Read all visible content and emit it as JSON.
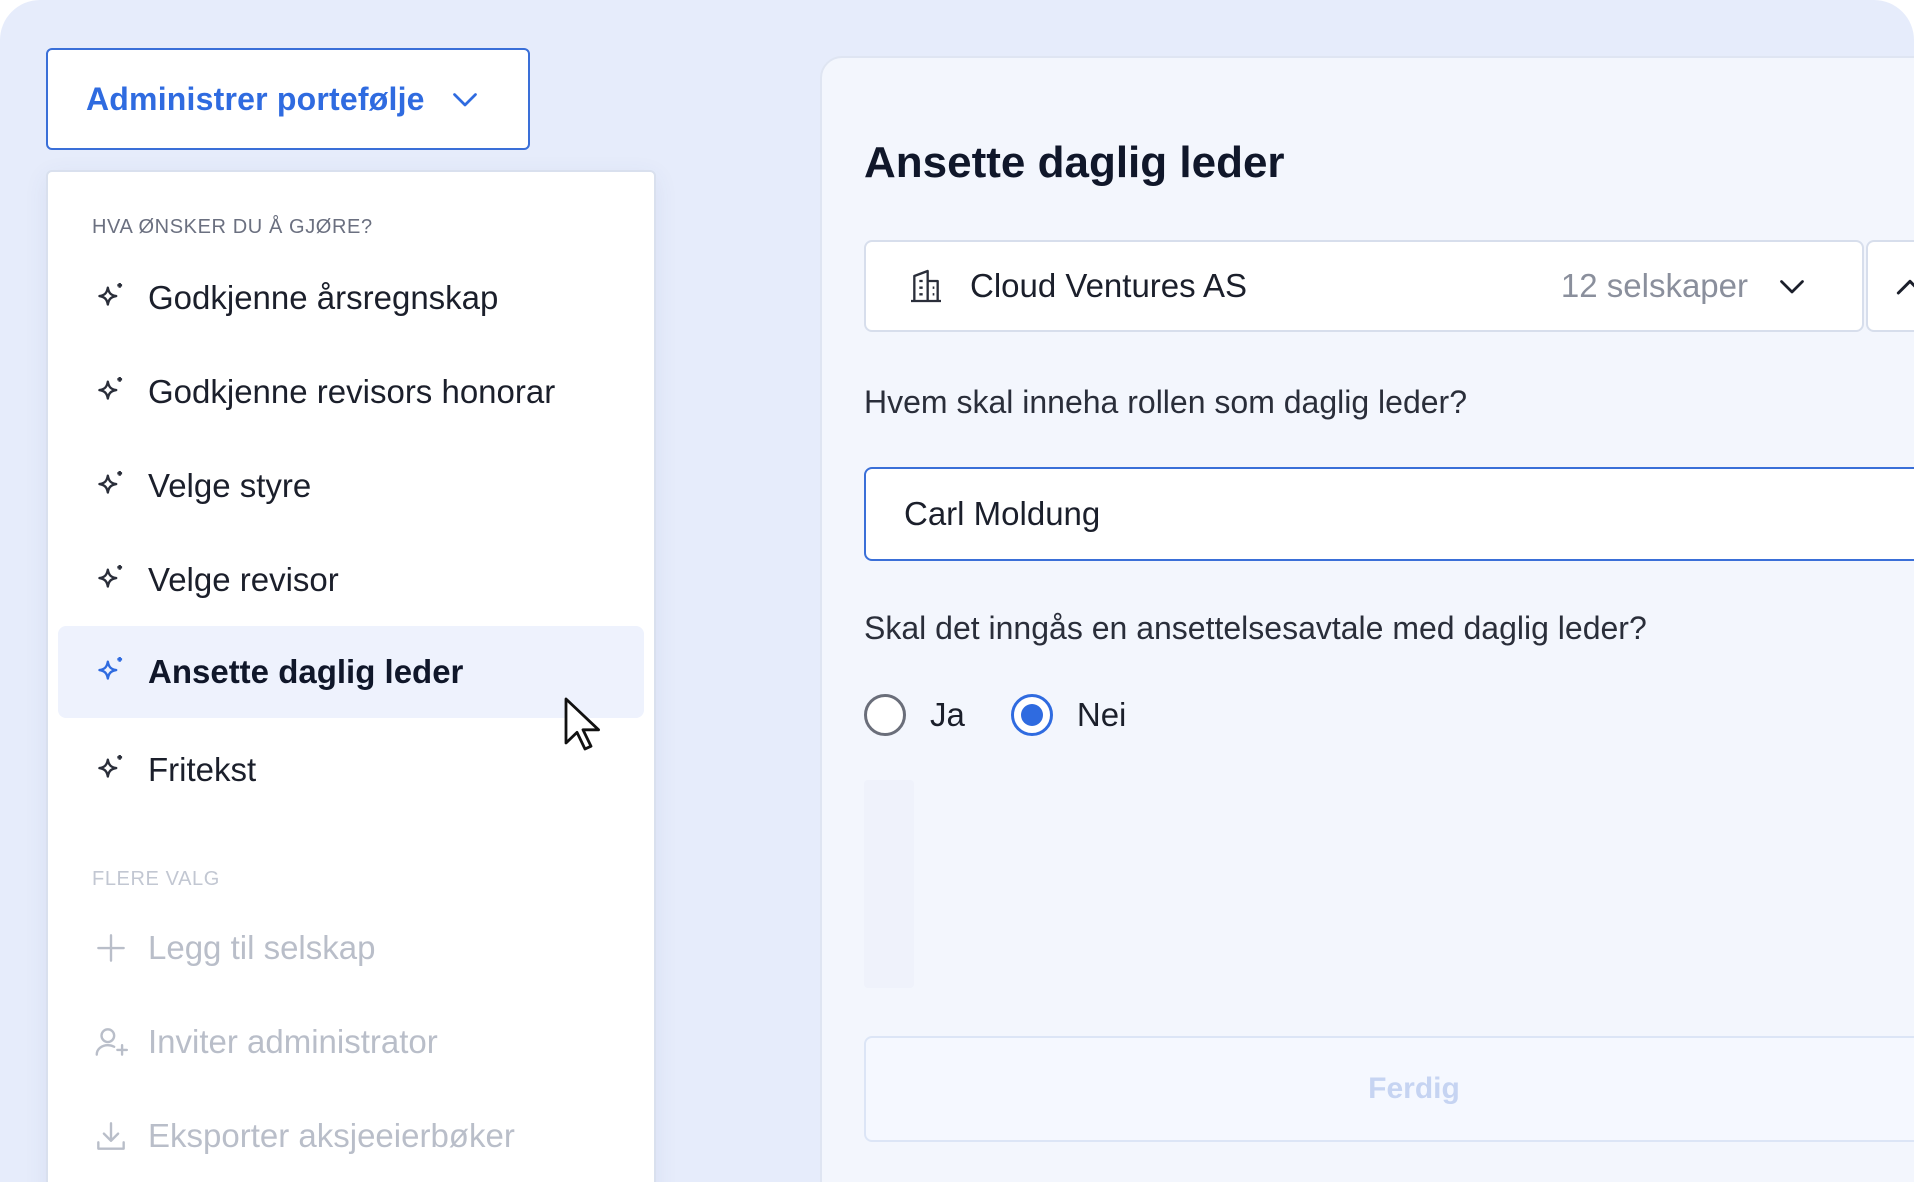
{
  "admin_menu": {
    "trigger_label": "Administrer portefølje",
    "section_actions": "HVA ØNSKER DU Å GJØRE?",
    "actions": [
      {
        "label": "Godkjenne årsregnskap",
        "icon": "sparkle-icon"
      },
      {
        "label": "Godkjenne revisors honorar",
        "icon": "sparkle-icon"
      },
      {
        "label": "Velge styre",
        "icon": "sparkle-icon"
      },
      {
        "label": "Velge revisor",
        "icon": "sparkle-icon"
      },
      {
        "label": "Ansette daglig leder",
        "icon": "sparkle-icon",
        "active": true
      },
      {
        "label": "Fritekst",
        "icon": "sparkle-icon"
      }
    ],
    "section_more": "FLERE VALG",
    "more": [
      {
        "label": "Legg til selskap",
        "icon": "plus-icon"
      },
      {
        "label": "Inviter administrator",
        "icon": "user-add-icon"
      },
      {
        "label": "Eksporter aksjeeierbøker",
        "icon": "download-icon"
      }
    ]
  },
  "form": {
    "title": "Ansette daglig leder",
    "company": {
      "name": "Cloud Ventures AS",
      "count_label": "12 selskaper",
      "icon": "building-icon"
    },
    "question_role": "Hvem skal inneha rollen som daglig leder?",
    "role_value": "Carl Moldung",
    "question_contract": "Skal det inngås en ansettelsesavtale med daglig leder?",
    "options": [
      {
        "label": "Ja",
        "selected": false
      },
      {
        "label": "Nei",
        "selected": true
      }
    ],
    "done_label": "Ferdig"
  },
  "colors": {
    "accent": "#2f6be0",
    "background": "#e6ecfb",
    "active_row": "#eef2fd"
  }
}
